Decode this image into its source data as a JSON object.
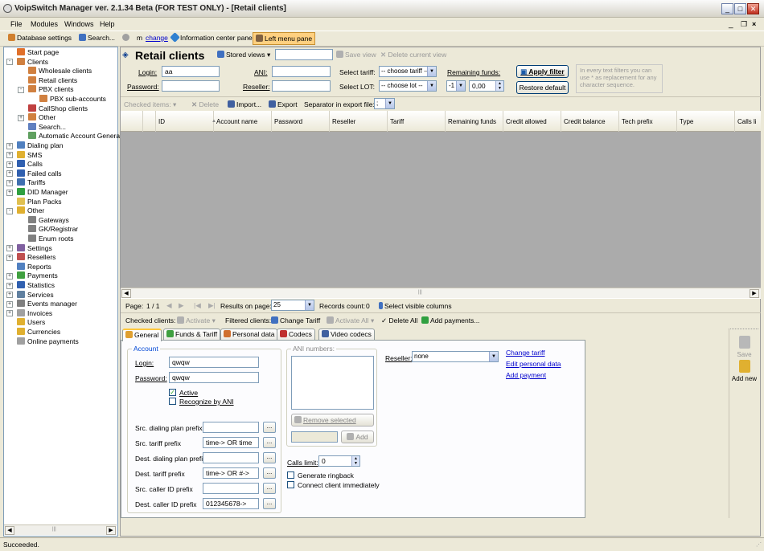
{
  "window": {
    "title": "VoipSwitch Manager ver. 2.1.34 Beta (FOR TEST ONLY) - [Retail clients]"
  },
  "menu": [
    "File",
    "Modules",
    "Windows",
    "Help"
  ],
  "toolbar": {
    "db_settings": "Database settings",
    "search": "Search...",
    "m": "m",
    "change": "change",
    "info_pane": "Information center pane",
    "left_menu": "Left menu pane"
  },
  "tree": [
    {
      "label": "Start page",
      "color": "#e0702a"
    },
    {
      "label": "Clients",
      "color": "#d08040"
    },
    {
      "label": "Wholesale clients",
      "color": "#d08040"
    },
    {
      "label": "Retail clients",
      "color": "#d08040"
    },
    {
      "label": "PBX clients",
      "color": "#d08040"
    },
    {
      "label": "PBX sub-accounts",
      "color": "#d08040"
    },
    {
      "label": "CallShop clients",
      "color": "#c04040"
    },
    {
      "label": "Other",
      "color": "#d08040"
    },
    {
      "label": "Search...",
      "color": "#6080c0"
    },
    {
      "label": "Automatic Account Generat",
      "color": "#60a060"
    },
    {
      "label": "Dialing plan",
      "color": "#5080c0"
    },
    {
      "label": "SMS",
      "color": "#e0b030"
    },
    {
      "label": "Calls",
      "color": "#3060b0"
    },
    {
      "label": "Failed calls",
      "color": "#3060b0"
    },
    {
      "label": "Tariffs",
      "color": "#4070b0"
    },
    {
      "label": "DID Manager",
      "color": "#30a040"
    },
    {
      "label": "Plan Packs",
      "color": "#e0c050"
    },
    {
      "label": "Other",
      "color": "#e0b030"
    },
    {
      "label": "Gateways",
      "color": "#808080"
    },
    {
      "label": "GK/Registrar",
      "color": "#808080"
    },
    {
      "label": "Enum roots",
      "color": "#808080"
    },
    {
      "label": "Settings",
      "color": "#8060a0"
    },
    {
      "label": "Resellers",
      "color": "#c05050"
    },
    {
      "label": "Reports",
      "color": "#5080c0"
    },
    {
      "label": "Payments",
      "color": "#40a040"
    },
    {
      "label": "Statistics",
      "color": "#3060b0"
    },
    {
      "label": "Services",
      "color": "#6080a0"
    },
    {
      "label": "Events manager",
      "color": "#808080"
    },
    {
      "label": "Invoices",
      "color": "#a0a0a0"
    },
    {
      "label": "Users",
      "color": "#e0b030"
    },
    {
      "label": "Currencies",
      "color": "#e0b030"
    },
    {
      "label": "Online payments",
      "color": "#a0a0a0"
    }
  ],
  "header": {
    "title": "Retail clients",
    "stored_views": "Stored views",
    "save_view": "Save view",
    "delete_view": "Delete current view"
  },
  "filter": {
    "login_label": "Login:",
    "login_value": "aa",
    "password_label": "Password:",
    "password_value": "",
    "ani_label": "ANI:",
    "ani_value": "",
    "reseller_label": "Reseller:",
    "reseller_value": "",
    "tariff_label": "Select tariff:",
    "tariff_value": "-- choose tariff --",
    "lot_label": "Select LOT:",
    "lot_value": "-- choose lot --",
    "funds_label": "Remaining funds:",
    "funds_op": "-1",
    "funds_value": "0,00",
    "apply": "Apply filter",
    "restore": "Restore default",
    "hint": "In every text filters you can use * as replacement for any character sequence."
  },
  "actions": {
    "checked": "Checked items:",
    "delete": "Delete",
    "import": "Import...",
    "export": "Export",
    "separator_label": "Separator in export file:",
    "separator_value": ";"
  },
  "columns": [
    "ID",
    "Account name",
    "Password",
    "Reseller",
    "Tariff",
    "Remaining funds",
    "Credit allowed",
    "Credit balance",
    "Tech prefix",
    "Type",
    "Calls li"
  ],
  "pager": {
    "page_label": "Page:",
    "page_value": "1 / 1",
    "results_label": "Results on page:",
    "results_value": "25",
    "records_label": "Records count:",
    "records_value": "0",
    "select_columns": "Select visible columns"
  },
  "bulk": {
    "checked": "Checked clients:",
    "activate": "Activate",
    "filtered": "Filtered clients:",
    "change_tariff": "Change Tariff",
    "activate_all": "Activate All",
    "delete_all": "Delete All",
    "add_payments": "Add payments..."
  },
  "tabs": [
    "General",
    "Funds & Tariff",
    "Personal data",
    "Codecs",
    "Video codecs"
  ],
  "general": {
    "account_group": "Account",
    "login_label": "Login:",
    "login_value": "qwqw",
    "password_label": "Password:",
    "password_value": "qwqw",
    "active": "Active",
    "recognize": "Recognize by ANI",
    "src_dial_label": "Src. dialing plan prefix",
    "src_dial_value": "",
    "src_tariff_label": "Src. tariff prefix",
    "src_tariff_value": "time-> OR time",
    "dest_dial_label": "Dest. dialing plan prefix",
    "dest_dial_value": "",
    "dest_tariff_label": "Dest. tariff prefix",
    "dest_tariff_value": "time-> OR #->",
    "src_caller_label": "Src. caller ID prefix",
    "src_caller_value": "",
    "dest_caller_label": "Dest. caller ID prefix",
    "dest_caller_value": "012345678->",
    "ani_group": "ANI numbers:",
    "remove_selected": "Remove selected",
    "add": "Add",
    "calls_limit_label": "Calls limit:",
    "calls_limit_value": "0",
    "ringback": "Generate ringback",
    "connect": "Connect client immediately",
    "reseller_label": "Reseller:",
    "reseller_value": "none",
    "change_tariff": "Change tariff",
    "edit_personal": "Edit personal data",
    "add_payment": "Add payment"
  },
  "side": {
    "save": "Save",
    "add_new": "Add new"
  },
  "status": "Succeeded."
}
